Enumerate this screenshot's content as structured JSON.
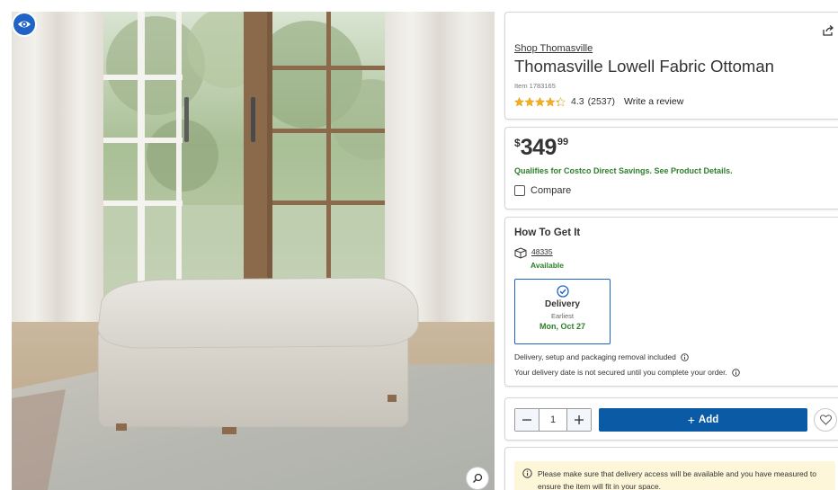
{
  "brand_link": "Shop Thomasville",
  "title": "Thomasville Lowell Fabric Ottoman",
  "item_number": "Item 1783165",
  "rating": {
    "stars": 4.3,
    "value": "4.3",
    "count": "(2537)",
    "write_review": "Write a review"
  },
  "price": {
    "currency": "$",
    "dollars": "349",
    "cents": "99"
  },
  "savings_text": "Qualifies for Costco Direct Savings. See Product Details.",
  "compare_label": "Compare",
  "how_to_get": {
    "title": "How To Get It",
    "zip": "48335",
    "availability": "Available",
    "delivery": {
      "label": "Delivery",
      "earliest_label": "Earliest",
      "date": "Mon, Oct 27"
    },
    "info_1": "Delivery, setup and packaging removal included",
    "info_2": "Your delivery date is not secured until you complete your order."
  },
  "purchase": {
    "quantity": "1",
    "add_label": "Add"
  },
  "notice": "Please make sure that delivery access will be available and you have measured to ensure the item will fit in your space.",
  "colors": {
    "accent_blue": "#0a5aa6",
    "green": "#2d7f2b",
    "star": "#f2b01e",
    "notice_bg": "#fdf6d8"
  },
  "icons": {
    "view_360": "eye-icon",
    "zoom": "zoom-icon",
    "share": "share-icon",
    "box": "package-icon",
    "check": "check-circle-icon",
    "info": "info-icon",
    "heart": "heart-icon"
  }
}
